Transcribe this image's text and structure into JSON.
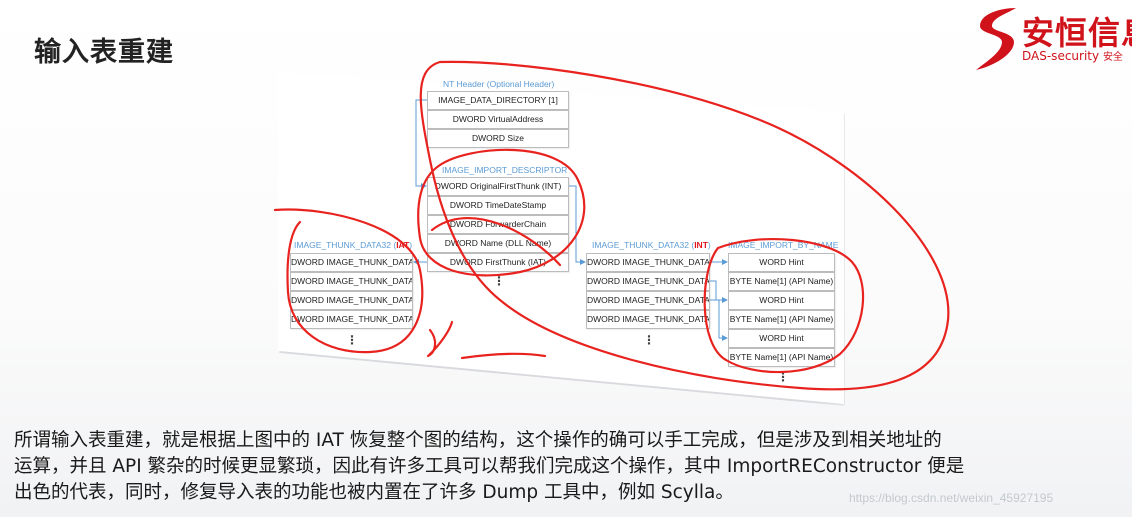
{
  "slide": {
    "title": "输入表重建"
  },
  "logo": {
    "cn_text": "安恒信息",
    "en_text": "DAS-security",
    "en_suffix": "安全"
  },
  "diagram": {
    "nt_header": {
      "title": "NT Header (Optional Header)",
      "fields": [
        "IMAGE_DATA_DIRECTORY [1]",
        "DWORD VirtualAddress",
        "DWORD Size"
      ]
    },
    "import_descriptor": {
      "title": "IMAGE_IMPORT_DESCRIPTOR",
      "fields": [
        "DWORD OriginalFirstThunk (INT)",
        "DWORD TimeDateStamp",
        "DWORD ForwarderChain",
        "DWORD Name (DLL Name)",
        "DWORD FirstThunk (IAT)"
      ]
    },
    "thunk_iat": {
      "title": "IMAGE_THUNK_DATA32 (",
      "title_tag": "IAT",
      "title_close": ")",
      "fields": [
        "DWORD IMAGE_THUNK_DATA",
        "DWORD IMAGE_THUNK_DATA",
        "DWORD IMAGE_THUNK_DATA",
        "DWORD IMAGE_THUNK_DATA"
      ]
    },
    "thunk_int": {
      "title": "IMAGE_THUNK_DATA32 (",
      "title_tag": "INT",
      "title_close": ")",
      "fields": [
        "DWORD IMAGE_THUNK_DATA",
        "DWORD IMAGE_THUNK_DATA",
        "DWORD IMAGE_THUNK_DATA",
        "DWORD IMAGE_THUNK_DATA"
      ]
    },
    "import_by_name": {
      "title": "IMAGE_IMPORT_BY_NAME",
      "fields": [
        "WORD Hint",
        "BYTE Name[1] (API Name)",
        "WORD Hint",
        "BYTE Name[1] (API Name)",
        "WORD Hint",
        "BYTE Name[1] (API Name)"
      ]
    },
    "ellipsis": "⋮"
  },
  "caption": {
    "lines": [
      "所谓输入表重建，就是根据上图中的 IAT 恢复整个图的结构，这个操作的确可以手工完成，但是涉及到相关地址的",
      "运算，并且 API 繁杂的时候更显繁琐，因此有许多工具可以帮我们完成这个操作，其中 ImportREConstructor 便是",
      "出色的代表，同时，修复导入表的功能也被内置在了许多 Dump 工具中，例如 Scylla。"
    ]
  },
  "watermark": "https://blog.csdn.net/weixin_45927195",
  "colors": {
    "accent_red": "#d0121b",
    "annotation_red": "#e8231f",
    "struct_title_blue": "#5b9bd5",
    "arrow_blue": "#5b9bd5"
  }
}
